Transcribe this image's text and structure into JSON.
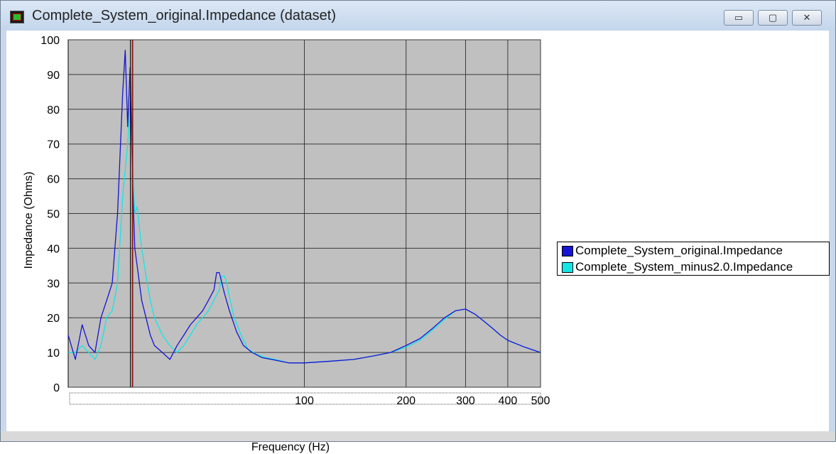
{
  "window": {
    "title": "Complete_System_original.Impedance (dataset)",
    "minimize_glyph": "▭",
    "maximize_glyph": "▢",
    "close_glyph": "✕"
  },
  "colors": {
    "plot_background": "#c0c0c0",
    "grid": "#3a3a3a",
    "original": "#1414d2",
    "minus": "#14e6e6",
    "cursor": "#8b1a1a"
  },
  "chart_data": {
    "type": "line",
    "xlabel": "Frequency (Hz)",
    "ylabel": "Impedance (Ohms)",
    "xscale": "log",
    "xlim": [
      20,
      500
    ],
    "ylim": [
      0,
      100
    ],
    "xticks": [
      100,
      200,
      300,
      400,
      500
    ],
    "xtick_labels": [
      "100",
      "200",
      "300",
      "400",
      "500"
    ],
    "yticks": [
      0,
      10,
      20,
      30,
      40,
      50,
      60,
      70,
      80,
      90,
      100
    ],
    "ytick_labels": [
      "0",
      "10",
      "20",
      "30",
      "40",
      "50",
      "60",
      "70",
      "80",
      "90",
      "100"
    ],
    "grid": true,
    "legend_position": "right",
    "cursor_x": 31,
    "series": [
      {
        "name": "Complete_System_original.Impedance",
        "x": [
          20,
          21,
          22,
          23,
          24,
          25,
          26,
          27,
          28,
          29,
          29.5,
          30,
          30.5,
          31,
          31.5,
          32,
          33,
          34,
          35,
          36,
          38,
          40,
          42,
          44,
          46,
          48,
          50,
          52,
          54,
          55,
          56,
          57,
          58,
          60,
          63,
          66,
          70,
          75,
          80,
          90,
          100,
          120,
          140,
          160,
          180,
          200,
          220,
          240,
          260,
          280,
          300,
          320,
          340,
          360,
          380,
          400,
          450,
          500
        ],
        "y": [
          15,
          8,
          18,
          12,
          10,
          20,
          25,
          30,
          50,
          85,
          97,
          75,
          92,
          60,
          40,
          35,
          25,
          20,
          15,
          12,
          10,
          8,
          12,
          15,
          18,
          20,
          22,
          25,
          28,
          33,
          33,
          30,
          27,
          22,
          16,
          12,
          10,
          8.5,
          8,
          7,
          7,
          7.5,
          8,
          9,
          10,
          12,
          14,
          17,
          20,
          22,
          22.5,
          21,
          19,
          17,
          15,
          13.5,
          11.5,
          10
        ]
      },
      {
        "name": "Complete_System_minus2.0.Impedance",
        "x": [
          20,
          21,
          22,
          23,
          24,
          25,
          26,
          27,
          28,
          29,
          30,
          30.5,
          31,
          31.5,
          32,
          33,
          34,
          35,
          36,
          38,
          40,
          42,
          44,
          46,
          48,
          50,
          52,
          54,
          56,
          57,
          58,
          59,
          60,
          62,
          65,
          68,
          72,
          77,
          82,
          90,
          100,
          120,
          140,
          160,
          180,
          200,
          220,
          240,
          260,
          280,
          300,
          320,
          340,
          360,
          380,
          400,
          450,
          500
        ],
        "y": [
          10,
          10,
          12,
          10,
          8,
          12,
          20,
          22,
          30,
          55,
          70,
          82,
          65,
          50,
          52,
          40,
          32,
          25,
          20,
          15,
          12,
          10,
          12,
          15,
          18,
          20,
          22,
          25,
          28,
          32,
          32,
          30,
          26,
          20,
          15,
          11,
          9.5,
          8.5,
          8,
          7,
          7,
          7.5,
          8,
          9,
          10,
          11.5,
          13.5,
          16.5,
          19.5,
          22,
          22.5,
          21,
          19,
          17,
          15,
          13.5,
          11.5,
          10
        ]
      }
    ]
  }
}
